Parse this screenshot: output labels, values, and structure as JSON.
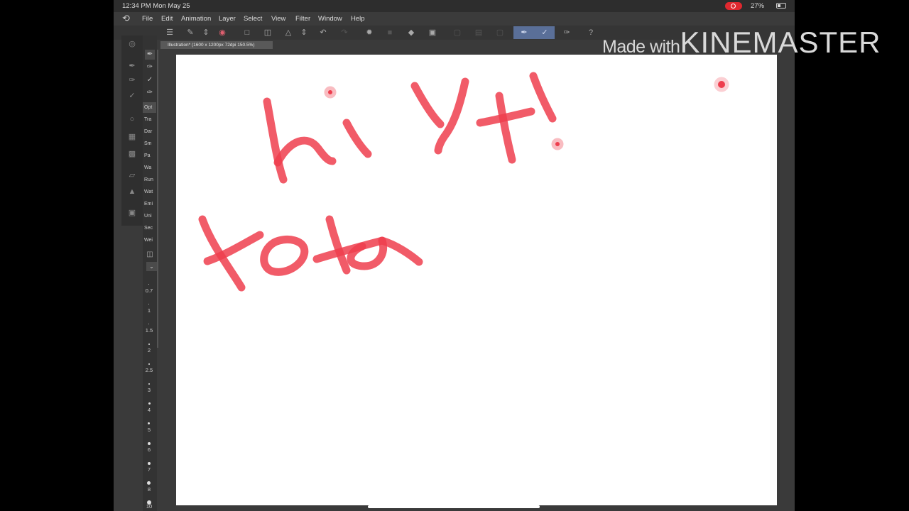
{
  "status_bar": {
    "time": "12:34 PM   Mon May 25",
    "battery": "27%"
  },
  "menu": {
    "items": [
      "File",
      "Edit",
      "Animation",
      "Layer",
      "Select",
      "View",
      "Filter",
      "Window",
      "Help"
    ]
  },
  "document_tab": {
    "label": "Illustration* (1600 x 1200px 72dpi 150.5%)"
  },
  "sub_tools": [
    "Opt",
    "Tra",
    "Dar",
    "Sm",
    "Pa",
    "Wa",
    "Run",
    "Wat",
    "Emi",
    "Uni",
    "Sec",
    "Wei"
  ],
  "brush_sizes": [
    "0.7",
    "1",
    "1.5",
    "2",
    "2.5",
    "3",
    "4",
    "5",
    "6",
    "7",
    "8",
    "10"
  ],
  "canvas": {
    "stroke_color": "#ee3e4e",
    "handwriting_lines": [
      "hi Yt!",
      "tota"
    ]
  },
  "watermark": {
    "prefix": "Made with",
    "brand": "KINEMASTER"
  }
}
